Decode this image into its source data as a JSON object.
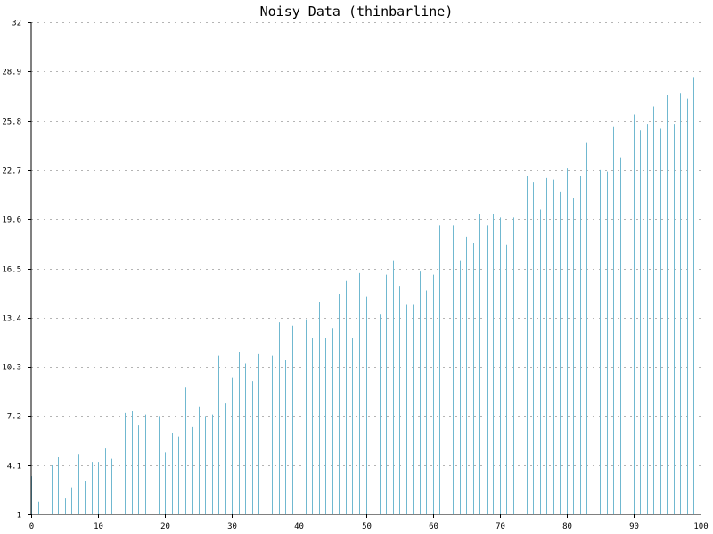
{
  "chart_data": {
    "type": "bar",
    "style": "thinbarline",
    "title": "Noisy Data (thinbarline)",
    "xlabel": "",
    "ylabel": "",
    "xlim": [
      0,
      100
    ],
    "ylim": [
      1,
      32
    ],
    "grid": true,
    "bar_color": "#70b8d0",
    "x_ticks": [
      "0",
      "10",
      "20",
      "30",
      "40",
      "50",
      "60",
      "70",
      "80",
      "90",
      "100"
    ],
    "y_ticks": [
      "1",
      "4.1",
      "7.2",
      "10.3",
      "13.4",
      "16.5",
      "19.6",
      "22.7",
      "25.8",
      "28.9",
      "32"
    ],
    "series": [
      {
        "x": [
          0,
          1,
          2,
          3,
          4,
          5,
          6,
          7,
          8,
          9,
          10,
          11,
          12,
          13,
          14,
          15,
          16,
          17,
          18,
          19,
          20,
          21,
          22,
          23,
          24,
          25,
          26,
          27,
          28,
          29,
          30,
          31,
          32,
          33,
          34,
          35,
          36,
          37,
          38,
          39,
          40,
          41,
          42,
          43,
          44,
          45,
          46,
          47,
          48,
          49,
          50,
          51,
          52,
          53,
          54,
          55,
          56,
          57,
          58,
          59,
          60,
          61,
          62,
          63,
          64,
          65,
          66,
          67,
          68,
          69,
          70,
          71,
          72,
          73,
          74,
          75,
          76,
          77,
          78,
          79,
          80,
          81,
          82,
          83,
          84,
          85,
          86,
          87,
          88,
          89,
          90,
          91,
          92,
          93,
          94,
          95,
          96,
          97,
          98,
          99,
          100
        ],
        "values": [
          3.4,
          1.8,
          3.7,
          4.1,
          4.6,
          2.0,
          2.7,
          4.8,
          3.1,
          4.3,
          4.3,
          5.2,
          4.5,
          5.3,
          7.4,
          7.5,
          6.6,
          7.3,
          4.9,
          7.2,
          4.9,
          6.1,
          5.9,
          9.0,
          6.5,
          7.8,
          7.2,
          7.3,
          11.0,
          8.0,
          9.6,
          11.2,
          10.5,
          9.4,
          11.1,
          10.8,
          11.0,
          13.1,
          10.7,
          12.9,
          12.1,
          13.3,
          12.1,
          14.4,
          12.1,
          12.7,
          14.9,
          15.7,
          12.1,
          16.2,
          14.7,
          13.1,
          13.6,
          16.1,
          17.0,
          15.4,
          14.2,
          14.2,
          16.3,
          15.1,
          16.1,
          19.2,
          19.2,
          19.2,
          17.0,
          18.5,
          18.1,
          19.9,
          19.2,
          19.9,
          19.7,
          18.0,
          19.7,
          22.1,
          22.3,
          21.9,
          20.2,
          22.2,
          22.1,
          21.3,
          22.8,
          20.9,
          22.3,
          24.4,
          24.4,
          22.7,
          22.6,
          25.4,
          23.5,
          25.2,
          26.2,
          25.2,
          25.6,
          26.7,
          25.3,
          27.4,
          25.6,
          27.5,
          27.2,
          28.5,
          28.5
        ]
      }
    ]
  }
}
